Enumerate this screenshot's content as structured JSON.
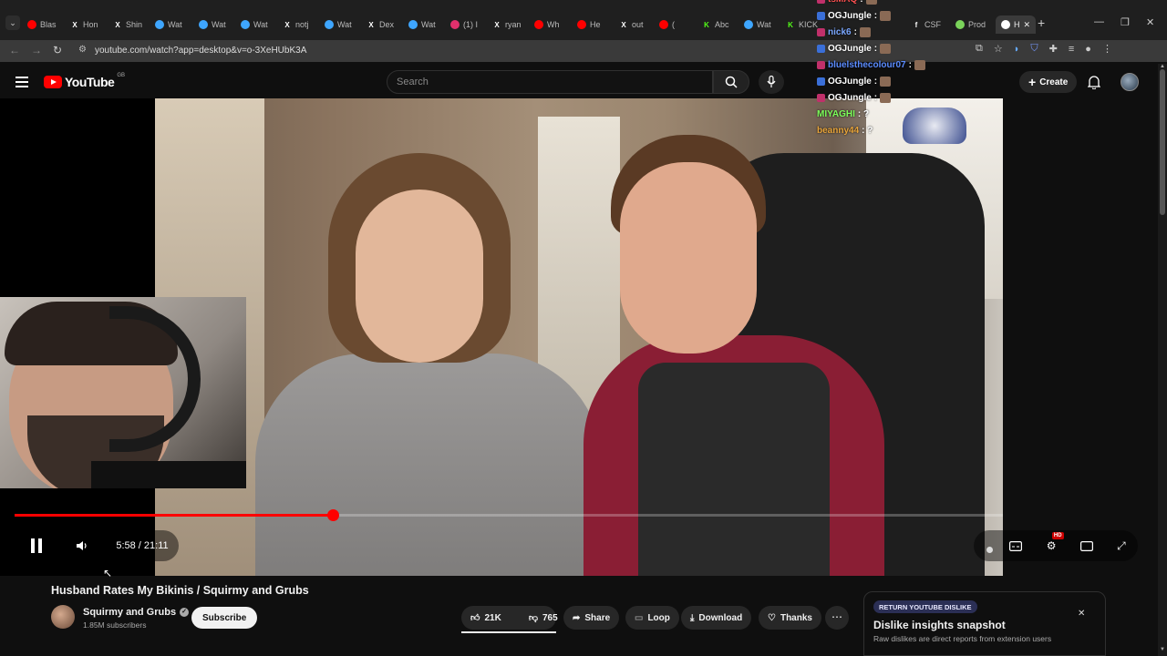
{
  "browser": {
    "tabs": [
      {
        "label": "Blas",
        "icon": "youtube-icon",
        "color": "#ff0000"
      },
      {
        "label": "Hon",
        "icon": "x-icon",
        "color": "#ffffff"
      },
      {
        "label": "Shin",
        "icon": "x-icon",
        "color": "#ffffff"
      },
      {
        "label": "Wat",
        "icon": "watch-icon",
        "color": "#3ea6ff"
      },
      {
        "label": "Wat",
        "icon": "watch-icon",
        "color": "#3ea6ff"
      },
      {
        "label": "Wat",
        "icon": "watch-icon",
        "color": "#3ea6ff"
      },
      {
        "label": "notj",
        "icon": "x-icon",
        "color": "#ffffff"
      },
      {
        "label": "Wat",
        "icon": "watch-icon",
        "color": "#3ea6ff"
      },
      {
        "label": "Dex",
        "icon": "x-icon",
        "color": "#ffffff"
      },
      {
        "label": "Wat",
        "icon": "watch-icon",
        "color": "#3ea6ff"
      },
      {
        "label": "(1) I",
        "icon": "instagram-icon",
        "color": "#e1306c"
      },
      {
        "label": "ryan",
        "icon": "x-icon",
        "color": "#ffffff"
      },
      {
        "label": "Wh",
        "icon": "youtube-icon",
        "color": "#ff0000"
      },
      {
        "label": "He",
        "icon": "youtube-icon",
        "color": "#ff0000"
      },
      {
        "label": "out",
        "icon": "x-icon",
        "color": "#ffffff"
      },
      {
        "label": "(",
        "icon": "youtube-icon",
        "color": "#ff0000"
      },
      {
        "label": "Abc",
        "icon": "kick-icon",
        "color": "#53fc18"
      },
      {
        "label": "Wat",
        "icon": "watch-icon",
        "color": "#3ea6ff"
      },
      {
        "label": "KICK",
        "icon": "kick-icon",
        "color": "#53fc18"
      },
      {
        "label": "CSF",
        "icon": "f-icon",
        "color": "#ffffff"
      },
      {
        "label": "Prod",
        "icon": "leaf-icon",
        "color": "#7ad35a"
      },
      {
        "label": "H",
        "icon": "audio-icon",
        "color": "#ffffff"
      }
    ],
    "url": "youtube.com/watch?app=desktop&v=o-3XeHUbK3A"
  },
  "youtube": {
    "logo_text": "YouTube",
    "region": "GB",
    "search_placeholder": "Search",
    "create_label": "Create"
  },
  "chat": [
    {
      "user": "tsMAQ",
      "text": ":",
      "color": "#ff5050"
    },
    {
      "user": "OGJungle",
      "text": ":",
      "color": "#ffffff"
    },
    {
      "user": "nick6",
      "text": ":",
      "color": "#7aa7ff"
    },
    {
      "user": "OGJungle",
      "text": ":",
      "color": "#ffffff"
    },
    {
      "user": "bluelsthecolour07",
      "text": ":",
      "color": "#5b8cff"
    },
    {
      "user": "OGJungle",
      "text": ":",
      "color": "#ffffff"
    },
    {
      "user": "OGJungle",
      "text": ":",
      "color": "#ffffff"
    },
    {
      "user": "MIYAGHI",
      "text": ": ?",
      "color": "#7cff5a"
    },
    {
      "user": "beanny44",
      "text": ": ?",
      "color": "#e8a43a"
    }
  ],
  "player": {
    "current_time": "5:58",
    "duration": "21:11",
    "time_display": "5:58 / 21:11",
    "progress_fraction": 0.322,
    "hd_badge": "HD"
  },
  "video": {
    "title": "Husband Rates My Bikinis / Squirmy and Grubs",
    "channel": "Squirmy and Grubs",
    "subscribers": "1.85M subscribers",
    "subscribe_label": "Subscribe",
    "likes": "21K",
    "dislikes": "765",
    "share_label": "Share",
    "loop_label": "Loop",
    "download_label": "Download",
    "thanks_label": "Thanks"
  },
  "dislike_panel": {
    "chip": "RETURN YOUTUBE DISLIKE",
    "title": "Dislike insights snapshot",
    "text": "Raw dislikes are direct reports from extension users"
  }
}
